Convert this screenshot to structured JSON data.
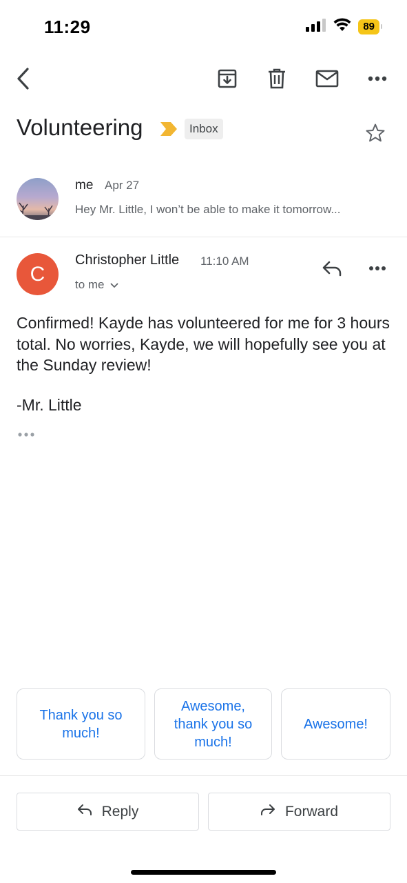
{
  "status_bar": {
    "time": "11:29",
    "battery": "89",
    "icons": [
      "cellular-signal-icon",
      "wifi-icon",
      "battery-icon"
    ]
  },
  "toolbar": {
    "icons": [
      "back-arrow-icon",
      "archive-icon",
      "trash-icon",
      "mark-unread-icon",
      "more-icon"
    ]
  },
  "thread": {
    "subject": "Volunteering",
    "label": "Inbox",
    "importance_icon": "importance-marker-icon",
    "star_icon": "star-outline-icon"
  },
  "collapsed_message": {
    "sender": "me",
    "date": "Apr 27",
    "snippet": "Hey Mr. Little, I won’t be able to make it tomorrow..."
  },
  "open_message": {
    "avatar_letter": "C",
    "sender": "Christopher Little",
    "time": "11:10 AM",
    "recipients": "to me",
    "body": "Confirmed! Kayde has volunteered for me for 3 hours total. No worries, Kayde, we will hopefully see you at the Sunday review!",
    "signature": "-Mr. Little"
  },
  "smart_replies": [
    {
      "label": "Thank you so much!"
    },
    {
      "label": "Awesome, thank you so much!"
    },
    {
      "label": "Awesome!"
    }
  ],
  "actions": {
    "reply": "Reply",
    "forward": "Forward"
  },
  "colors": {
    "accent_blue": "#1a73e8",
    "avatar_orange": "#e8573a",
    "importance_yellow": "#f2b632",
    "battery_yellow": "#f5c518"
  }
}
